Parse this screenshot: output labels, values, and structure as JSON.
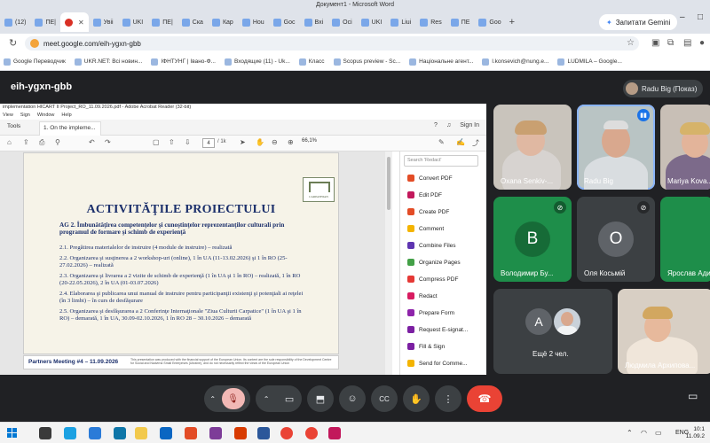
{
  "window": {
    "title": "Документ1 - Microsoft Word"
  },
  "tabs": [
    {
      "label": "(12)"
    },
    {
      "label": "ПЕ|"
    },
    {
      "label": ""
    },
    {
      "label": "Увіі"
    },
    {
      "label": "UKI"
    },
    {
      "label": "ПЕ|"
    },
    {
      "label": "Ска"
    },
    {
      "label": "Кар"
    },
    {
      "label": "Hou"
    },
    {
      "label": "Goc"
    },
    {
      "label": "Вхі"
    },
    {
      "label": "Осі"
    },
    {
      "label": "UKI"
    },
    {
      "label": "Liui"
    },
    {
      "label": "Res"
    },
    {
      "label": "ПЕ"
    },
    {
      "label": "Goo"
    }
  ],
  "gemini_label": "Запитати Gemini",
  "address": {
    "url": "meet.google.com/eih-ygxn-gbb"
  },
  "bookmarks": [
    "Google Переводчик",
    "UKR.NET: Всі новин...",
    "ІФНТУНГ | Івано-Ф...",
    "Входящие (11) - Uk...",
    "Класс",
    "Scopus preview - Sc...",
    "Національне агент...",
    "l.konsevich@nung.e...",
    "LUDMILA – Google..."
  ],
  "meet": {
    "code": "eih-ygxn-gbb",
    "presenter": "Radu Big (Показ)"
  },
  "acrobat": {
    "title": "implementation HICART II Project_RO_11.09.2026.pdf - Adobe Acrobat Reader (32-bit)",
    "menu": [
      "View",
      "Sign",
      "Window",
      "Help"
    ],
    "tab_tools": "Tools",
    "tab_doc": "1. On the impleme...",
    "sign_in": "Sign In",
    "page": "4",
    "page_total": "/ 1k",
    "zoom": "66,1%",
    "search_placeholder": "Search 'Redact'",
    "tools": [
      {
        "label": "Convert PDF",
        "color": "#e34c26"
      },
      {
        "label": "Edit PDF",
        "color": "#c2185b"
      },
      {
        "label": "Create PDF",
        "color": "#e34c26"
      },
      {
        "label": "Comment",
        "color": "#f4b400"
      },
      {
        "label": "Combine Files",
        "color": "#5e35b1"
      },
      {
        "label": "Organize Pages",
        "color": "#43a047"
      },
      {
        "label": "Compress PDF",
        "color": "#e53935"
      },
      {
        "label": "Redact",
        "color": "#d81b60"
      },
      {
        "label": "Prepare Form",
        "color": "#8e24aa"
      },
      {
        "label": "Request E-signat...",
        "color": "#7b1fa2"
      },
      {
        "label": "Fill & Sign",
        "color": "#7b1fa2"
      },
      {
        "label": "Send for Comme...",
        "color": "#f4b400"
      }
    ]
  },
  "slide": {
    "logo_text": "CARPATHIAN",
    "title": "ACTIVITĂŢILE PROIECTULUI",
    "ag": "AG 2. Îmbunătăţirea competenţelor şi cunoştinţelor reprezentanţilor culturali prin programul de formare şi schimb de experienţă",
    "items": [
      "2.1. Pregătirea materialelor de instruire (4 module de instruire) – realizată",
      "2.2. Organizarea şi susţinerea a 2 workshop-uri (online), 1 în UA (11-13.02.2026) şi 1 în RO (25-27.02.2026) – realizată",
      "2.3. Organizarea şi livrarea a 2 vizite de schimb de experienţă (1 în UA şi 1 în RO) – realizată, 1 în RO (20-22.05.2026), 2 în UA (01-03.07.2026)",
      "2.4. Elaborarea şi publicarea unui manual de instruire pentru participanţii existenţi şi potenţiali ai reţelei (în 3 limbi) – în curs de desfăşurare",
      "2.5. Organizarea şi desfăşurarea a 2 Conferinţe Internaţionale \"Ziua Culturii Carpatice\" (1 în UA şi 1 în RO) – demarată, 1 în UA, 30.09-02.10.2026, 1 în RO 28 – 30.10.2026 – demarată"
    ],
    "footer": "Partners  Meeting #4 – 11.09.2026",
    "disclaimer": "This presentation was produced with the financial support of the European Union. Its content are the sole responsibility of the Development Centre for Social and Nadvirna Small Enterprises (Ukraine), and do not necessarily reflect the views of the European Union"
  },
  "participants": [
    {
      "name": "Oxana Senkiv-...",
      "kind": "video"
    },
    {
      "name": "Radu Big",
      "kind": "video"
    },
    {
      "name": "Mariya Kova...",
      "kind": "video"
    },
    {
      "name": "Володимир Бу...",
      "initial": "В",
      "color": "#1f6e43",
      "kind": "avatar"
    },
    {
      "name": "Оля Косьмій",
      "initial": "О",
      "color": "#5f6368",
      "kind": "avatar"
    },
    {
      "name": "Ярослав Ади...",
      "kind": "green"
    },
    {
      "name": "Ещё 2 чел.",
      "initial": "A",
      "color": "#5f6368",
      "kind": "more"
    },
    {
      "name": "Людмила Архипова...",
      "kind": "video"
    }
  ],
  "taskbar": {
    "lang": "ENG",
    "time": "10:1",
    "date": "11.09.2"
  }
}
